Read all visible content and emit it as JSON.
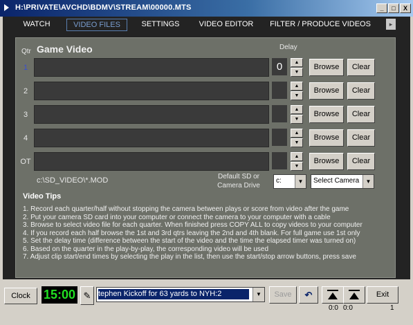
{
  "window": {
    "title": "H:\\PRIVATE\\AVCHD\\BDMV\\STREAM\\00000.MTS",
    "minimize": "_",
    "maximize": "□",
    "close": "X"
  },
  "tabs": [
    {
      "label": "WATCH",
      "active": false
    },
    {
      "label": "VIDEO FILES",
      "active": true
    },
    {
      "label": "SETTINGS",
      "active": false
    },
    {
      "label": "VIDEO EDITOR",
      "active": false
    },
    {
      "label": "FILTER / PRODUCE VIDEOS",
      "active": false
    }
  ],
  "video_files": {
    "qtr_label": "Qtr",
    "heading": "Game Video",
    "delay_label": "Delay",
    "rows": [
      {
        "qtr": "1",
        "video": "",
        "delay": "0",
        "browse": "Browse",
        "clear": "Clear"
      },
      {
        "qtr": "2",
        "video": "",
        "delay": "",
        "browse": "Browse",
        "clear": "Clear"
      },
      {
        "qtr": "3",
        "video": "",
        "delay": "",
        "browse": "Browse",
        "clear": "Clear"
      },
      {
        "qtr": "4",
        "video": "",
        "delay": "",
        "browse": "Browse",
        "clear": "Clear"
      },
      {
        "qtr": "OT",
        "video": "",
        "delay": "",
        "browse": "Browse",
        "clear": "Clear"
      }
    ],
    "default_path": "c:\\SD_VIDEO\\*.MOD",
    "default_drive_label_line1": "Default SD or",
    "default_drive_label_line2": "Camera Drive",
    "drive_value": "c:",
    "camera_select_value": "Select Camera"
  },
  "tips": {
    "title": "Video Tips",
    "lines": [
      "1. Record each quarter/half without stopping the camera between plays or score from video after the game",
      "2. Put your camera SD card into your computer or connect the camera to your computer with a cable",
      "3. Browse to select video file for each quarter.  When finished press COPY ALL to copy videos to your computer",
      "4. If you record each half browse the 1st and 3rd qtrs leaving the 2nd and 4th blank. For full game use 1st only",
      "5. Set the delay time (difference between the start of the video and the time the elapsed timer was turned on)",
      "6. Based on the quarter in the play-by-play, the corresponding video will be used",
      "7. Adjust clip start/end times by selecting the play in the list, then use the start/stop arrow buttons, press save"
    ]
  },
  "bottom": {
    "clock_label": "Clock",
    "timer_value": "15:00",
    "play_value": "tephen Kickoff for 63 yards to NYH:2",
    "save_label": "Save",
    "exit_label": "Exit",
    "clip_start_time": "0:0",
    "clip_end_time": "0:0",
    "page_number": "1"
  },
  "colors": {
    "title_gradient_start": "#0a246a",
    "panel": "#6d7068",
    "timer_text": "#22e022"
  }
}
